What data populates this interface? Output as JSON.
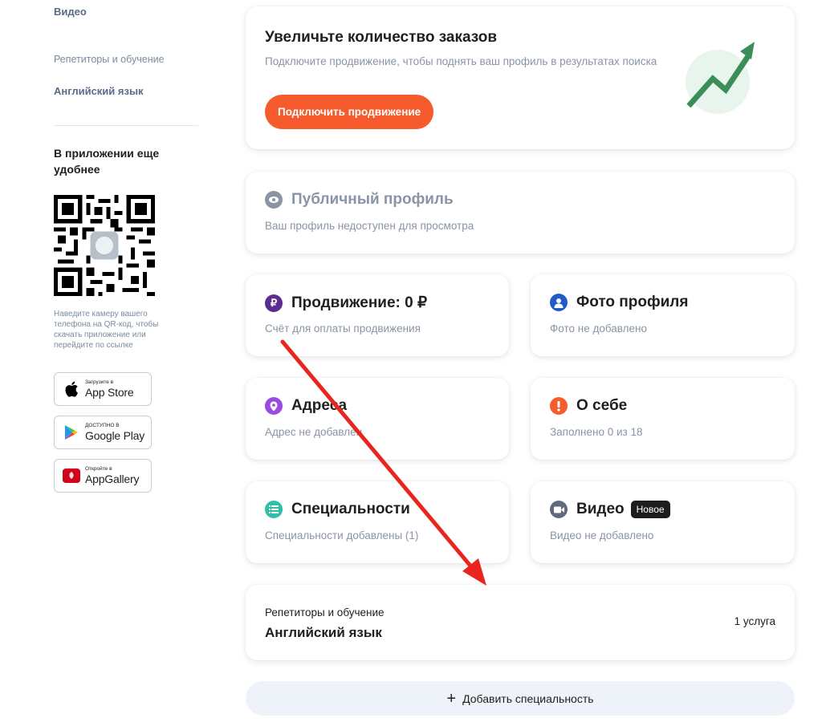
{
  "sidebar": {
    "video_link": "Видео",
    "category": "Репетиторы и обучение",
    "subcategory": "Английский язык",
    "app_title": "В приложении еще удобнее",
    "qr_hint": "Наведите камеру вашего телефона на QR-код, чтобы скачать приложение или перейдите по ссылке",
    "stores": [
      {
        "small": "Загрузите в",
        "name": "App Store",
        "icon": "apple-icon"
      },
      {
        "small": "ДОСТУПНО В",
        "name": "Google Play",
        "icon": "google-play-icon"
      },
      {
        "small": "Откройте в",
        "name": "AppGallery",
        "icon": "huawei-icon"
      }
    ]
  },
  "promo": {
    "title": "Увеличьте количество заказов",
    "description": "Подключите продвижение, чтобы поднять ваш профиль в результатах поиска",
    "button": "Подключить продвижение",
    "accent": "#f55b2c"
  },
  "public_profile": {
    "title": "Публичный профиль",
    "subtitle": "Ваш профиль недоступен для просмотра",
    "icon": "eye-icon"
  },
  "tiles": {
    "promotion": {
      "title": "Продвижение: 0 ₽",
      "subtitle": "Счёт для оплаты продвижения",
      "icon": "ruble-icon",
      "color": "#5b2d91"
    },
    "photo": {
      "title": "Фото профиля",
      "subtitle": "Фото не добавлено",
      "icon": "user-icon",
      "color": "#1f5cc7"
    },
    "address": {
      "title": "Адреса",
      "subtitle": "Адрес не добавлен",
      "icon": "location-pin-icon",
      "color": "#9b4be0"
    },
    "about": {
      "title": "О себе",
      "subtitle": "Заполнено 0 из 18",
      "icon": "info-icon",
      "color": "#f55b2c"
    },
    "specialties": {
      "title": "Специальности",
      "subtitle": "Специальности добавлены (1)",
      "icon": "list-icon",
      "color": "#2fbfa6"
    },
    "video": {
      "title": "Видео",
      "badge": "Новое",
      "subtitle": "Видео не добавлено",
      "icon": "video-camera-icon",
      "color": "#5f6b7d"
    }
  },
  "specialty_item": {
    "category": "Репетиторы и обучение",
    "name": "Английский язык",
    "count": "1 услуга"
  },
  "add_specialty": {
    "label": "Добавить специальность"
  },
  "annotation": {
    "arrow_color": "#e8251f"
  }
}
